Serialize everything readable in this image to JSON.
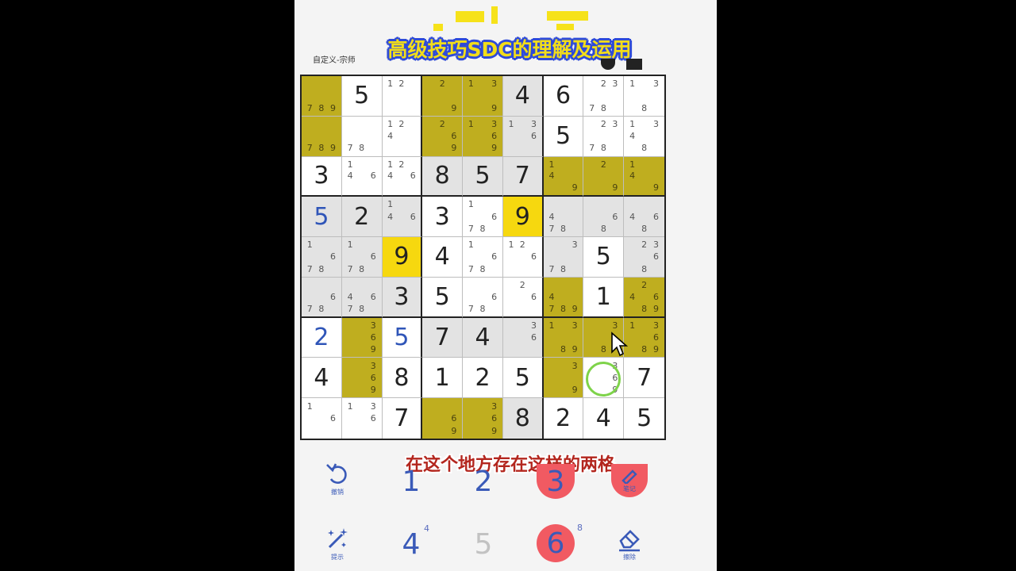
{
  "video": {
    "title": "高级技巧SDC的理解及运用",
    "subtitle": "在这个地方存在这样的两格"
  },
  "app": {
    "mode_label": "自定义-宗师"
  },
  "grid": [
    [
      {
        "v": "",
        "n": [
          7,
          8,
          9
        ],
        "bg": "olive"
      },
      {
        "v": "5"
      },
      {
        "v": "",
        "n": [
          1,
          2
        ]
      },
      {
        "v": "",
        "n": [
          2,
          9
        ],
        "bg": "olive"
      },
      {
        "v": "",
        "n": [
          1,
          3,
          9
        ],
        "bg": "olive"
      },
      {
        "v": "4",
        "bg": "gray"
      },
      {
        "v": "6"
      },
      {
        "v": "",
        "n": [
          2,
          3,
          7,
          8
        ]
      },
      {
        "v": "",
        "n": [
          1,
          3,
          8
        ]
      }
    ],
    [
      {
        "v": "",
        "n": [
          7,
          8,
          9
        ],
        "bg": "olive"
      },
      {
        "v": "",
        "n": [
          7,
          8
        ]
      },
      {
        "v": "",
        "n": [
          1,
          2,
          4
        ]
      },
      {
        "v": "",
        "n": [
          2,
          6,
          9
        ],
        "bg": "olive"
      },
      {
        "v": "",
        "n": [
          1,
          3,
          6,
          9
        ],
        "bg": "olive"
      },
      {
        "v": "",
        "n": [
          1,
          3,
          6
        ],
        "bg": "gray"
      },
      {
        "v": "5"
      },
      {
        "v": "",
        "n": [
          2,
          3,
          7,
          8
        ]
      },
      {
        "v": "",
        "n": [
          1,
          3,
          4,
          8
        ]
      }
    ],
    [
      {
        "v": "3"
      },
      {
        "v": "",
        "n": [
          1,
          4,
          6
        ]
      },
      {
        "v": "",
        "n": [
          1,
          2,
          4,
          6
        ]
      },
      {
        "v": "8",
        "bg": "gray"
      },
      {
        "v": "5",
        "bg": "gray"
      },
      {
        "v": "7",
        "bg": "gray"
      },
      {
        "v": "",
        "n": [
          1,
          4,
          9
        ],
        "bg": "olive"
      },
      {
        "v": "",
        "n": [
          2,
          9
        ],
        "bg": "olive"
      },
      {
        "v": "",
        "n": [
          1,
          4,
          9
        ],
        "bg": "olive"
      }
    ],
    [
      {
        "v": "5",
        "bg": "gray",
        "blue": true
      },
      {
        "v": "2",
        "bg": "gray"
      },
      {
        "v": "",
        "n": [
          1,
          4,
          6
        ],
        "bg": "gray"
      },
      {
        "v": "3"
      },
      {
        "v": "",
        "n": [
          1,
          6,
          7,
          8
        ]
      },
      {
        "v": "9",
        "bg": "yellow"
      },
      {
        "v": "",
        "n": [
          4,
          7,
          8
        ],
        "bg": "gray"
      },
      {
        "v": "",
        "n": [
          6,
          8
        ],
        "bg": "gray"
      },
      {
        "v": "",
        "n": [
          4,
          6,
          8
        ],
        "bg": "gray"
      }
    ],
    [
      {
        "v": "",
        "n": [
          1,
          6,
          7,
          8
        ],
        "bg": "gray"
      },
      {
        "v": "",
        "n": [
          1,
          6,
          7,
          8
        ],
        "bg": "gray"
      },
      {
        "v": "9",
        "bg": "yellow"
      },
      {
        "v": "4"
      },
      {
        "v": "",
        "n": [
          1,
          6,
          7,
          8
        ]
      },
      {
        "v": "",
        "n": [
          1,
          2,
          6
        ]
      },
      {
        "v": "",
        "n": [
          3,
          7,
          8
        ],
        "bg": "gray"
      },
      {
        "v": "5"
      },
      {
        "v": "",
        "n": [
          2,
          3,
          6,
          8
        ],
        "bg": "gray"
      }
    ],
    [
      {
        "v": "",
        "n": [
          6,
          7,
          8
        ],
        "bg": "gray"
      },
      {
        "v": "",
        "n": [
          4,
          6,
          7,
          8
        ],
        "bg": "gray"
      },
      {
        "v": "3",
        "bg": "gray"
      },
      {
        "v": "5"
      },
      {
        "v": "",
        "n": [
          6,
          7,
          8
        ]
      },
      {
        "v": "",
        "n": [
          2,
          6
        ]
      },
      {
        "v": "",
        "n": [
          4,
          7,
          8,
          9
        ],
        "bg": "olive"
      },
      {
        "v": "1"
      },
      {
        "v": "",
        "n": [
          2,
          4,
          6,
          8,
          9
        ],
        "bg": "olive"
      }
    ],
    [
      {
        "v": "2",
        "blue": true
      },
      {
        "v": "",
        "n": [
          3,
          6,
          9
        ],
        "bg": "olive"
      },
      {
        "v": "5",
        "blue": true
      },
      {
        "v": "7",
        "bg": "gray"
      },
      {
        "v": "4",
        "bg": "gray"
      },
      {
        "v": "",
        "n": [
          3,
          6
        ],
        "bg": "gray"
      },
      {
        "v": "",
        "n": [
          1,
          3,
          8,
          9
        ],
        "bg": "olive"
      },
      {
        "v": "",
        "n": [
          3,
          8
        ],
        "bg": "olive"
      },
      {
        "v": "",
        "n": [
          1,
          3,
          6,
          8,
          9
        ],
        "bg": "olive"
      }
    ],
    [
      {
        "v": "4"
      },
      {
        "v": "",
        "n": [
          3,
          6,
          9
        ],
        "bg": "olive"
      },
      {
        "v": "8"
      },
      {
        "v": "1"
      },
      {
        "v": "2"
      },
      {
        "v": "5"
      },
      {
        "v": "",
        "n": [
          3,
          9
        ],
        "bg": "olive"
      },
      {
        "v": "",
        "n": [
          3,
          6,
          9
        ]
      },
      {
        "v": "7"
      }
    ],
    [
      {
        "v": "",
        "n": [
          1,
          6
        ]
      },
      {
        "v": "",
        "n": [
          1,
          3,
          6
        ]
      },
      {
        "v": "7"
      },
      {
        "v": "",
        "n": [
          6,
          9
        ],
        "bg": "olive"
      },
      {
        "v": "",
        "n": [
          3,
          6,
          9
        ],
        "bg": "olive"
      },
      {
        "v": "8",
        "bg": "gray"
      },
      {
        "v": "2"
      },
      {
        "v": "4"
      },
      {
        "v": "5"
      }
    ]
  ],
  "keypad": {
    "undo_label": "撤销",
    "hint_label": "提示",
    "notes_label": "笔记",
    "erase_label": "擦除",
    "digits": {
      "d1": "1",
      "d2": "2",
      "d3": "3",
      "d4": "4",
      "d4_count": "4",
      "d5": "5",
      "d6": "6",
      "d6_count": "8"
    }
  },
  "colors": {
    "olive_highlight": "#bfae1f",
    "yellow_highlight": "#f6d80f",
    "accent_blue": "#3a5ab8",
    "keypad_red": "#f15a62"
  }
}
